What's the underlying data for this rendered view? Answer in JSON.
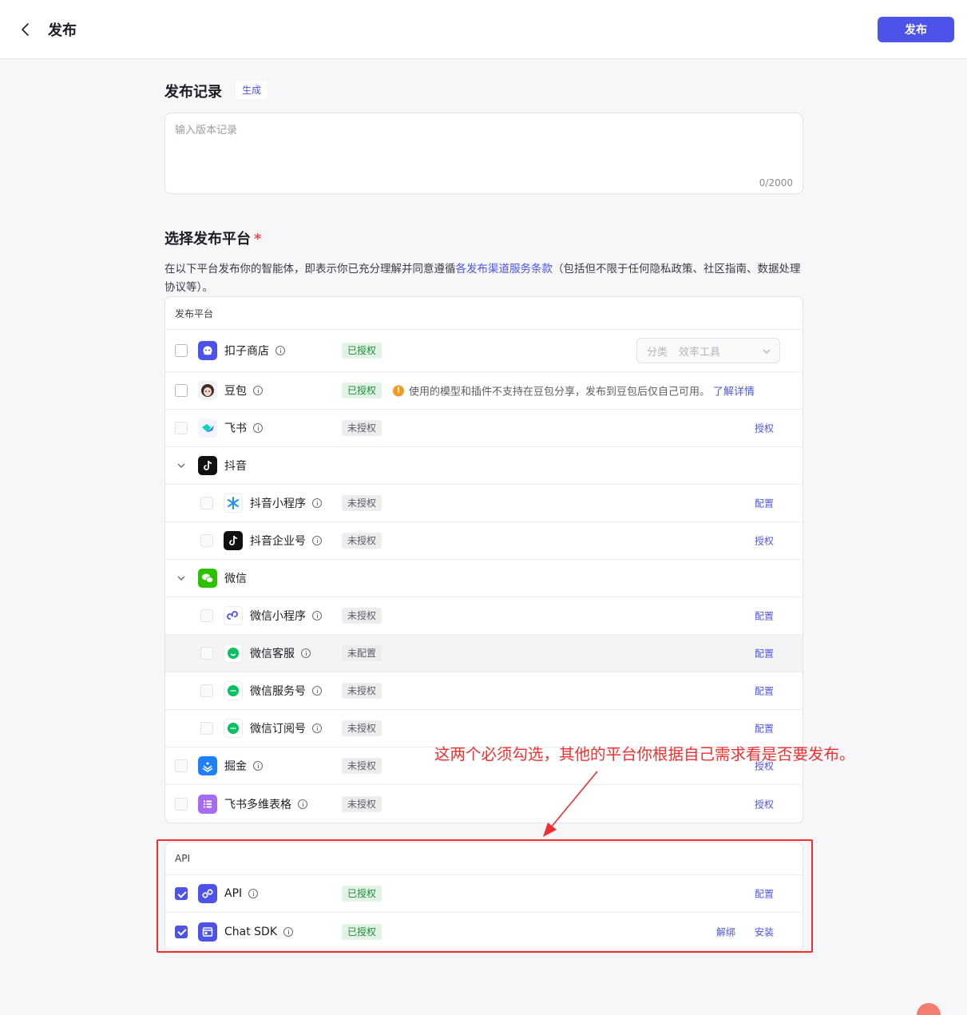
{
  "header": {
    "title": "发布",
    "publish_label": "发布"
  },
  "record": {
    "title": "发布记录",
    "generate_label": "生成",
    "placeholder": "输入版本记录",
    "value": "",
    "counter": "0/2000"
  },
  "platforms_section": {
    "title": "选择发布平台",
    "required_mark": "*",
    "desc_prefix": "在以下平台发布你的智能体，即表示你已充分理解并同意遵循",
    "desc_link": "各发布渠道服务条款",
    "desc_suffix": "（包括但不限于任何隐私政策、社区指南、数据处理协议等）。"
  },
  "platform_card": {
    "header": "发布平台",
    "coze_store": {
      "name": "扣子商店",
      "status": "已授权",
      "checked": false,
      "category_label": "分类",
      "category_value": "效率工具"
    },
    "doubao": {
      "name": "豆包",
      "status": "已授权",
      "checked": false,
      "warning": "使用的模型和插件不支持在豆包分享，发布到豆包后仅自己可用。",
      "warning_icon": "!",
      "warning_link": "了解详情"
    },
    "feishu": {
      "name": "飞书",
      "status": "未授权",
      "action": "授权"
    },
    "douyin_group": {
      "name": "抖音",
      "expanded": true
    },
    "douyin_mini": {
      "name": "抖音小程序",
      "status": "未授权",
      "action": "配置"
    },
    "douyin_ent": {
      "name": "抖音企业号",
      "status": "未授权",
      "action": "授权"
    },
    "wechat_group": {
      "name": "微信",
      "expanded": true
    },
    "wechat_mini": {
      "name": "微信小程序",
      "status": "未授权",
      "action": "配置"
    },
    "wechat_kf": {
      "name": "微信客服",
      "status": "未配置",
      "action": "配置"
    },
    "wechat_service": {
      "name": "微信服务号",
      "status": "未授权",
      "action": "配置"
    },
    "wechat_sub": {
      "name": "微信订阅号",
      "status": "未授权",
      "action": "配置"
    },
    "juejin": {
      "name": "掘金",
      "status": "未授权",
      "action": "授权"
    },
    "feishu_base": {
      "name": "飞书多维表格",
      "status": "未授权",
      "action": "授权"
    }
  },
  "api_card": {
    "header": "API",
    "api": {
      "name": "API",
      "status": "已授权",
      "checked": true,
      "action": "配置"
    },
    "chat_sdk": {
      "name": "Chat SDK",
      "status": "已授权",
      "checked": true,
      "action_unbind": "解绑",
      "action_install": "安装"
    }
  },
  "annotation": {
    "text": "这两个必须勾选，其他的平台你根据自己需求看是否要发布。",
    "color": "#f32e2e"
  },
  "colors": {
    "accent": "#4d53e8",
    "authorized_bg": "#e3f4e6",
    "authorized_text": "#1e8a3c",
    "warning": "#f59a23"
  }
}
